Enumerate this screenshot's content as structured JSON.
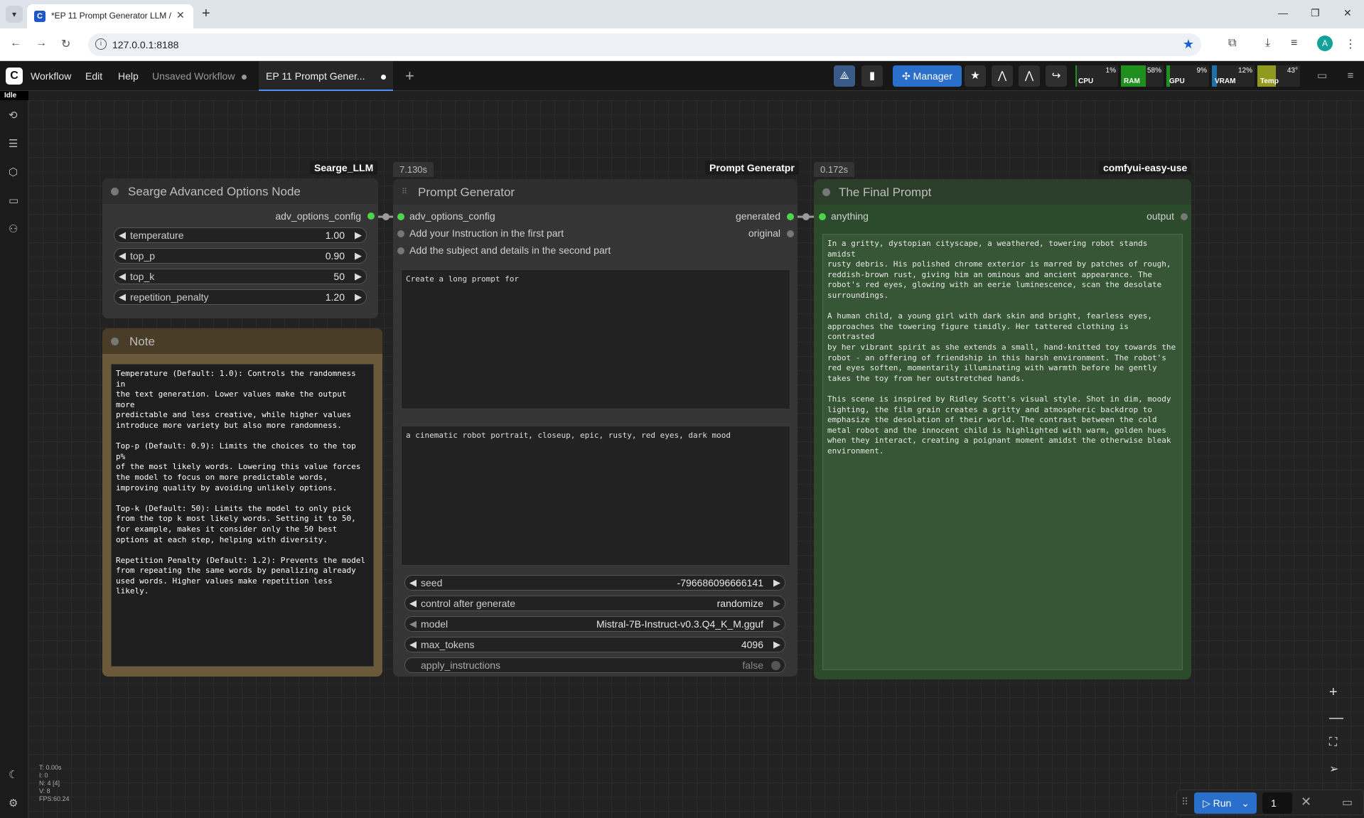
{
  "browser": {
    "tab_title": "*EP 11 Prompt Generator LLM /",
    "url": "127.0.0.1:8188",
    "profile_initial": "A"
  },
  "menu": {
    "items": [
      "Workflow",
      "Edit",
      "Help"
    ],
    "tabs": [
      {
        "label": "Unsaved Workflow",
        "active": false
      },
      {
        "label": "EP 11 Prompt Gener...",
        "active": true
      }
    ],
    "manager_label": "Manager",
    "status": "Idle"
  },
  "monitor": [
    {
      "label": "CPU",
      "value": "1%",
      "fraction": 0.01,
      "color": "#1f8f1f"
    },
    {
      "label": "RAM",
      "value": "58%",
      "fraction": 0.58,
      "color": "#1f8f1f"
    },
    {
      "label": "GPU",
      "value": "9%",
      "fraction": 0.09,
      "color": "#1f8f1f"
    },
    {
      "label": "VRAM",
      "value": "12%",
      "fraction": 0.12,
      "color": "#1f6fa8"
    },
    {
      "label": "Temp",
      "value": "43°",
      "fraction": 0.43,
      "color": "#8f9a1f"
    }
  ],
  "nodes": {
    "advanced": {
      "badge": "Searge_LLM",
      "title": "Searge Advanced Options Node",
      "output": "adv_options_config",
      "widgets": [
        {
          "label": "temperature",
          "value": "1.00"
        },
        {
          "label": "top_p",
          "value": "0.90"
        },
        {
          "label": "top_k",
          "value": "50"
        },
        {
          "label": "repetition_penalty",
          "value": "1.20"
        }
      ]
    },
    "note": {
      "title": "Note",
      "text": "Temperature (Default: 1.0): Controls the randomness in\nthe text generation. Lower values make the output more\npredictable and less creative, while higher values\nintroduce more variety but also more randomness.\n\nTop-p (Default: 0.9): Limits the choices to the top p%\nof the most likely words. Lowering this value forces\nthe model to focus on more predictable words,\nimproving quality by avoiding unlikely options.\n\nTop-k (Default: 50): Limits the model to only pick\nfrom the top k most likely words. Setting it to 50,\nfor example, makes it consider only the 50 best\noptions at each step, helping with diversity.\n\nRepetition Penalty (Default: 1.2): Prevents the model\nfrom repeating the same words by penalizing already\nused words. Higher values make repetition less likely."
    },
    "generator": {
      "badge": "Prompt Generatpr",
      "time": "7.130s",
      "title": "Prompt Generator",
      "inputs": [
        "adv_options_config",
        "Add your Instruction in the first part",
        "Add the subject and details in the second part"
      ],
      "outputs": [
        "generated",
        "original"
      ],
      "instruction": "Create a long prompt for",
      "subject": "a cinematic robot portrait, closeup, epic, rusty, red eyes, dark mood",
      "widgets": [
        {
          "label": "seed",
          "value": "-796686096666141"
        },
        {
          "label": "control after generate",
          "value": "randomize"
        },
        {
          "label": "model",
          "value": "Mistral-7B-Instruct-v0.3.Q4_K_M.gguf"
        },
        {
          "label": "max_tokens",
          "value": "4096"
        },
        {
          "label": "apply_instructions",
          "value": "false"
        }
      ]
    },
    "final": {
      "badge": "comfyui-easy-use",
      "time": "0.172s",
      "title": "The Final Prompt",
      "input": "anything",
      "output": "output",
      "text": "In a gritty, dystopian cityscape, a weathered, towering robot stands amidst\nrusty debris. His polished chrome exterior is marred by patches of rough,\nreddish-brown rust, giving him an ominous and ancient appearance. The\nrobot's red eyes, glowing with an eerie luminescence, scan the desolate\nsurroundings.\n\nA human child, a young girl with dark skin and bright, fearless eyes,\napproaches the towering figure timidly. Her tattered clothing is contrasted\nby her vibrant spirit as she extends a small, hand-knitted toy towards the\nrobot - an offering of friendship in this harsh environment. The robot's\nred eyes soften, momentarily illuminating with warmth before he gently\ntakes the toy from her outstretched hands.\n\nThis scene is inspired by Ridley Scott's visual style. Shot in dim, moody\nlighting, the film grain creates a gritty and atmospheric backdrop to\nemphasize the desolation of their world. The contrast between the cold\nmetal robot and the innocent child is highlighted with warm, golden hues\nwhen they interact, creating a poignant moment amidst the otherwise bleak\nenvironment."
    }
  },
  "graph_info": [
    "T: 0.00s",
    "I: 0",
    "N: 4 [4]",
    "V: 8",
    "FPS:60.24"
  ],
  "run": {
    "label": "Run",
    "count": "1"
  }
}
